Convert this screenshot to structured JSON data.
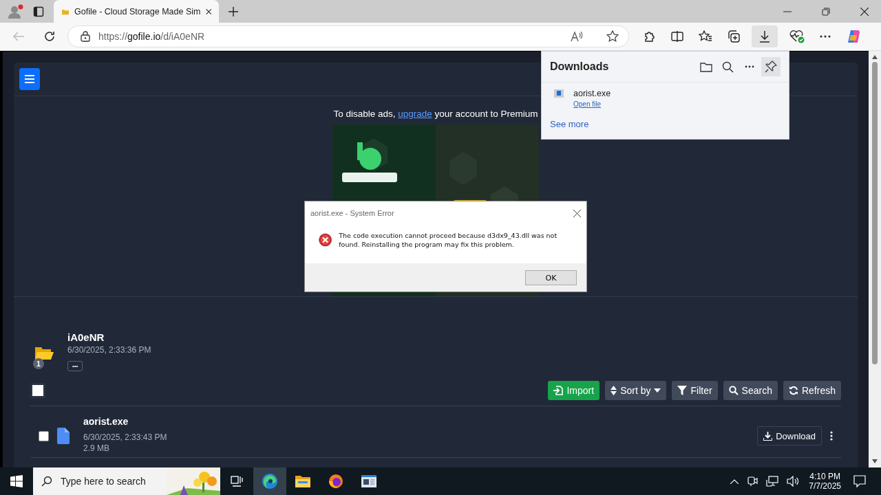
{
  "browser": {
    "tabs": [
      {
        "title": "Gofile - Cloud Storage Made Sim",
        "selected": true
      }
    ],
    "address": {
      "host": "gofile.io",
      "scheme": "https://",
      "path": "/d/iA0eNR"
    }
  },
  "page": {
    "ad_notice": {
      "before": "To disable ads, ",
      "link": "upgrade",
      "after": " your account to Premium"
    },
    "folder": {
      "name": "iA0eNR",
      "date": "6/30/2025, 2:33:36 PM",
      "badge": "1",
      "more": "•••"
    },
    "select_all": {
      "checked": false
    },
    "actions": [
      {
        "kind": "import",
        "label": "Import"
      },
      {
        "kind": "sort",
        "label": "Sort by"
      },
      {
        "kind": "filter",
        "label": "Filter"
      },
      {
        "kind": "search",
        "label": "Search"
      },
      {
        "kind": "refresh",
        "label": "Refresh"
      }
    ],
    "files": [
      {
        "name": "aorist.exe",
        "date": "6/30/2025, 2:33:43 PM",
        "size": "2.9 MB",
        "checked": false,
        "action": "Download"
      }
    ]
  },
  "downloads_panel": {
    "title": "Downloads",
    "items": [
      {
        "name": "aorist.exe",
        "action": "Open file"
      }
    ],
    "see_more": "See more"
  },
  "dialog": {
    "title": "aorist.exe - System Error",
    "message": "The code execution cannot proceed because d3dx9_43.dll was not found. Reinstalling the program may fix this problem.",
    "button": "OK"
  },
  "taskbar": {
    "search_placeholder": "Type here to search",
    "apps": [
      {
        "kind": "task-view",
        "active": false
      },
      {
        "kind": "edge",
        "active": true
      },
      {
        "kind": "explorer",
        "active": false
      },
      {
        "kind": "firefox",
        "active": false
      },
      {
        "kind": "window-app",
        "active": false
      }
    ],
    "time": "4:10 PM",
    "date": "7/7/2025"
  }
}
